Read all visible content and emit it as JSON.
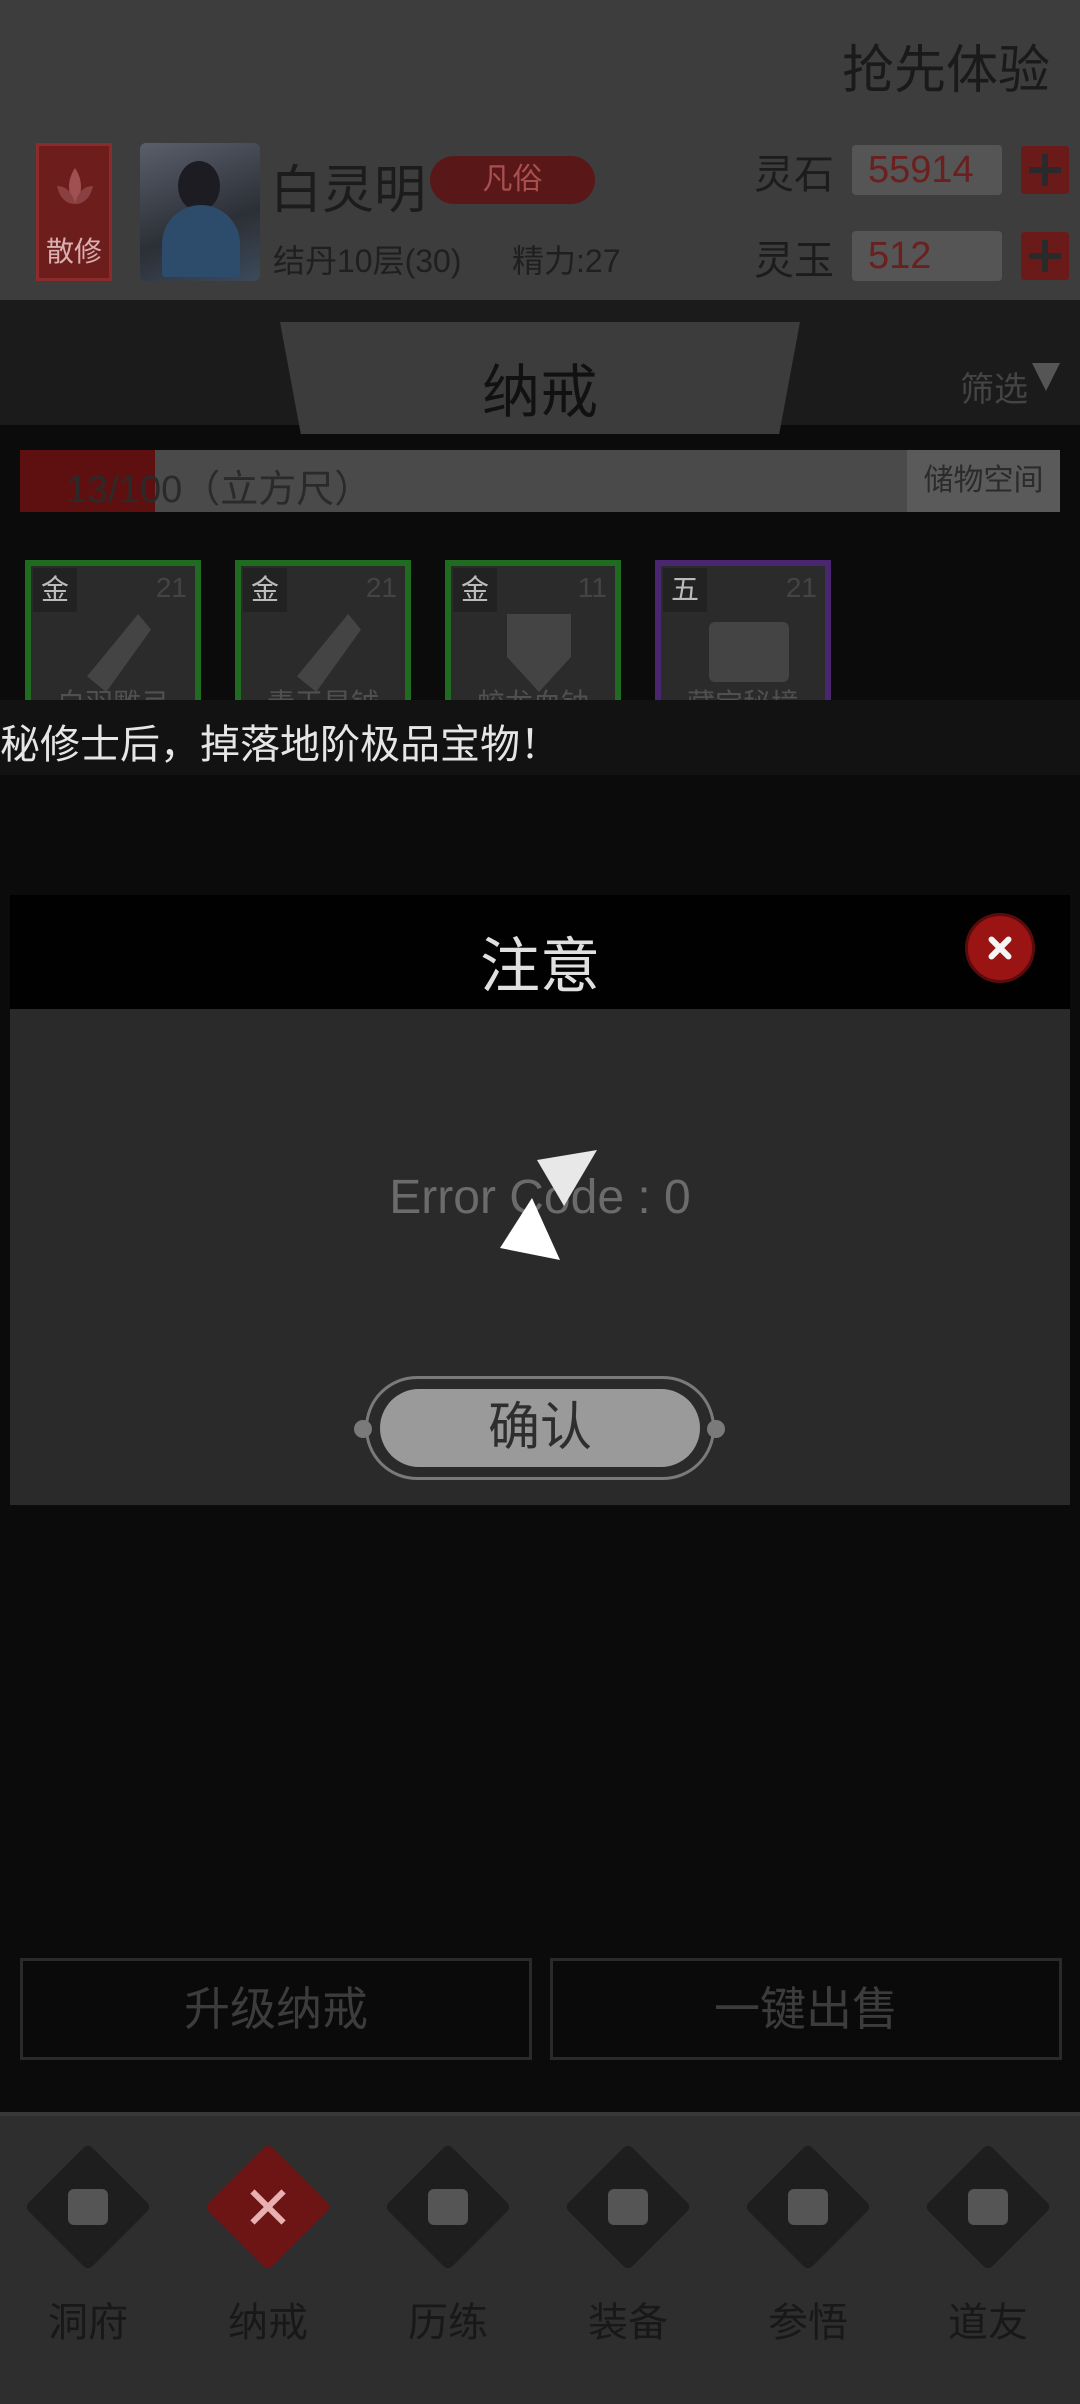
{
  "header": {
    "early_access": "抢先体验",
    "badge_label": "散修",
    "player_name": "白灵明",
    "rank": "凡俗",
    "cultivation": "结丹10层(30)",
    "energy": "精力:27",
    "currencies": [
      {
        "label": "灵石",
        "value": "55914"
      },
      {
        "label": "灵玉",
        "value": "512"
      }
    ]
  },
  "ring": {
    "title": "纳戒",
    "filter_label": "筛选",
    "capacity_text": "13/100（立方尺）",
    "capacity_used": 13,
    "capacity_total": 100,
    "storage_button": "储物空间",
    "items": [
      {
        "grade": "金",
        "level": "21",
        "name": "白羽雕弓"
      },
      {
        "grade": "金",
        "level": "21",
        "name": "青玉星钺"
      },
      {
        "grade": "金",
        "level": "11",
        "name": "蛟龙血钟"
      },
      {
        "grade": "五",
        "level": "21",
        "name": "藏宝秘境"
      }
    ]
  },
  "banner": {
    "text": "秘修士后，掉落地阶极品宝物！"
  },
  "dialog": {
    "title": "注意",
    "message": "Error Code : 0",
    "confirm_label": "确认"
  },
  "actions": {
    "upgrade_label": "升级纳戒",
    "sell_label": "一键出售"
  },
  "nav": {
    "items": [
      {
        "label": "洞府",
        "icon": "gate-icon"
      },
      {
        "label": "纳戒",
        "icon": "ring-icon"
      },
      {
        "label": "历练",
        "icon": "swords-icon"
      },
      {
        "label": "装备",
        "icon": "dagger-icon"
      },
      {
        "label": "参悟",
        "icon": "book-icon"
      },
      {
        "label": "道友",
        "icon": "handshake-icon"
      }
    ],
    "active": "纳戒"
  },
  "colors": {
    "overlay": "#000000",
    "accent_red": "#9a1414",
    "grade_gold_border": "#2a8a2a",
    "grade_five_border": "#6a3aa0"
  }
}
